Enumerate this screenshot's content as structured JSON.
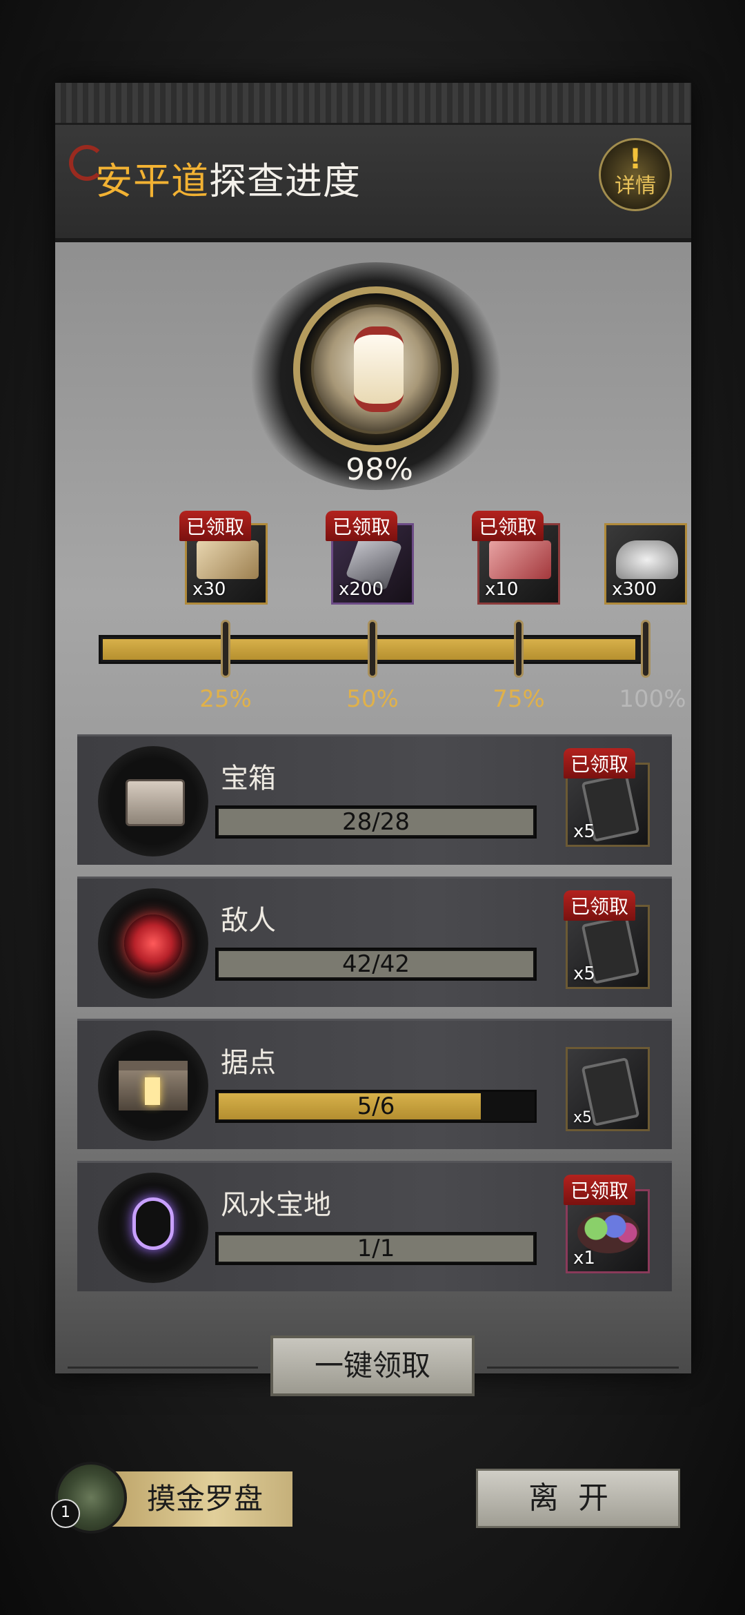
{
  "header": {
    "title_place": "安平道",
    "title_rest": "探查进度",
    "detail_label": "详情",
    "detail_mark": "!"
  },
  "overall": {
    "progress_text": "98%",
    "progress": 0.98
  },
  "milestones": [
    {
      "label": "25%",
      "qty": "x30",
      "status": "已领取",
      "reached": true
    },
    {
      "label": "50%",
      "qty": "x200",
      "status": "已领取",
      "reached": true
    },
    {
      "label": "75%",
      "qty": "x10",
      "status": "已领取",
      "reached": true
    },
    {
      "label": "100%",
      "qty": "x300",
      "status": "",
      "reached": false
    }
  ],
  "tasks": [
    {
      "name": "宝箱",
      "progress_text": "28/28",
      "progress": 1.0,
      "reward_qty": "x5",
      "status": "已领取",
      "icon": "treasure-chest-icon"
    },
    {
      "name": "敌人",
      "progress_text": "42/42",
      "progress": 1.0,
      "reward_qty": "x5",
      "status": "已领取",
      "icon": "demon-skull-icon"
    },
    {
      "name": "据点",
      "progress_text": "5/6",
      "progress": 0.8333,
      "reward_qty": "x5",
      "status": "",
      "icon": "stronghold-icon"
    },
    {
      "name": "风水宝地",
      "progress_text": "1/1",
      "progress": 1.0,
      "reward_qty": "x1",
      "status": "已领取",
      "icon": "fengshui-spot-icon"
    }
  ],
  "actions": {
    "claim_all": "一键领取",
    "compass": "摸金罗盘",
    "compass_badge": "1",
    "leave": "离开"
  },
  "colors": {
    "accent_gold": "#f2b233",
    "claimed_red": "#b3221e",
    "bar_gold": "#d7b04a"
  }
}
